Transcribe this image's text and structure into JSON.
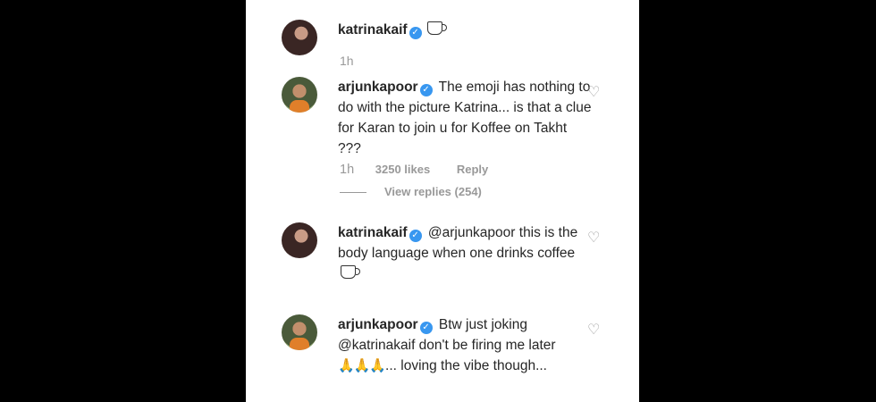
{
  "comments": [
    {
      "user": "katrinakaif",
      "text": "",
      "emoji": "coffee-cup"
    },
    {
      "user": "arjunkapoor",
      "text": "The emoji has nothing to do with the picture Katrina... is that a clue for Karan to join u for Koffee on Takht ???",
      "time": "1h",
      "likes": "3250 likes",
      "reply": "Reply",
      "view_replies": "View replies (254)"
    },
    {
      "user": "katrinakaif",
      "text": "@arjunkapoor this is the body language when one drinks coffee",
      "emoji": "coffee-cup"
    },
    {
      "user": "arjunkapoor",
      "text_before": "Btw just joking @katrinakaif don't be firing me later",
      "emoji_text": "🙏🙏🙏",
      "text_after": "... loving the vibe though..."
    }
  ],
  "first_time": "1h",
  "icons": {
    "verified": "verified-badge-icon",
    "like": "heart-icon"
  },
  "colors": {
    "verified": "#3897f0",
    "text": "#262626",
    "muted": "#999999"
  }
}
